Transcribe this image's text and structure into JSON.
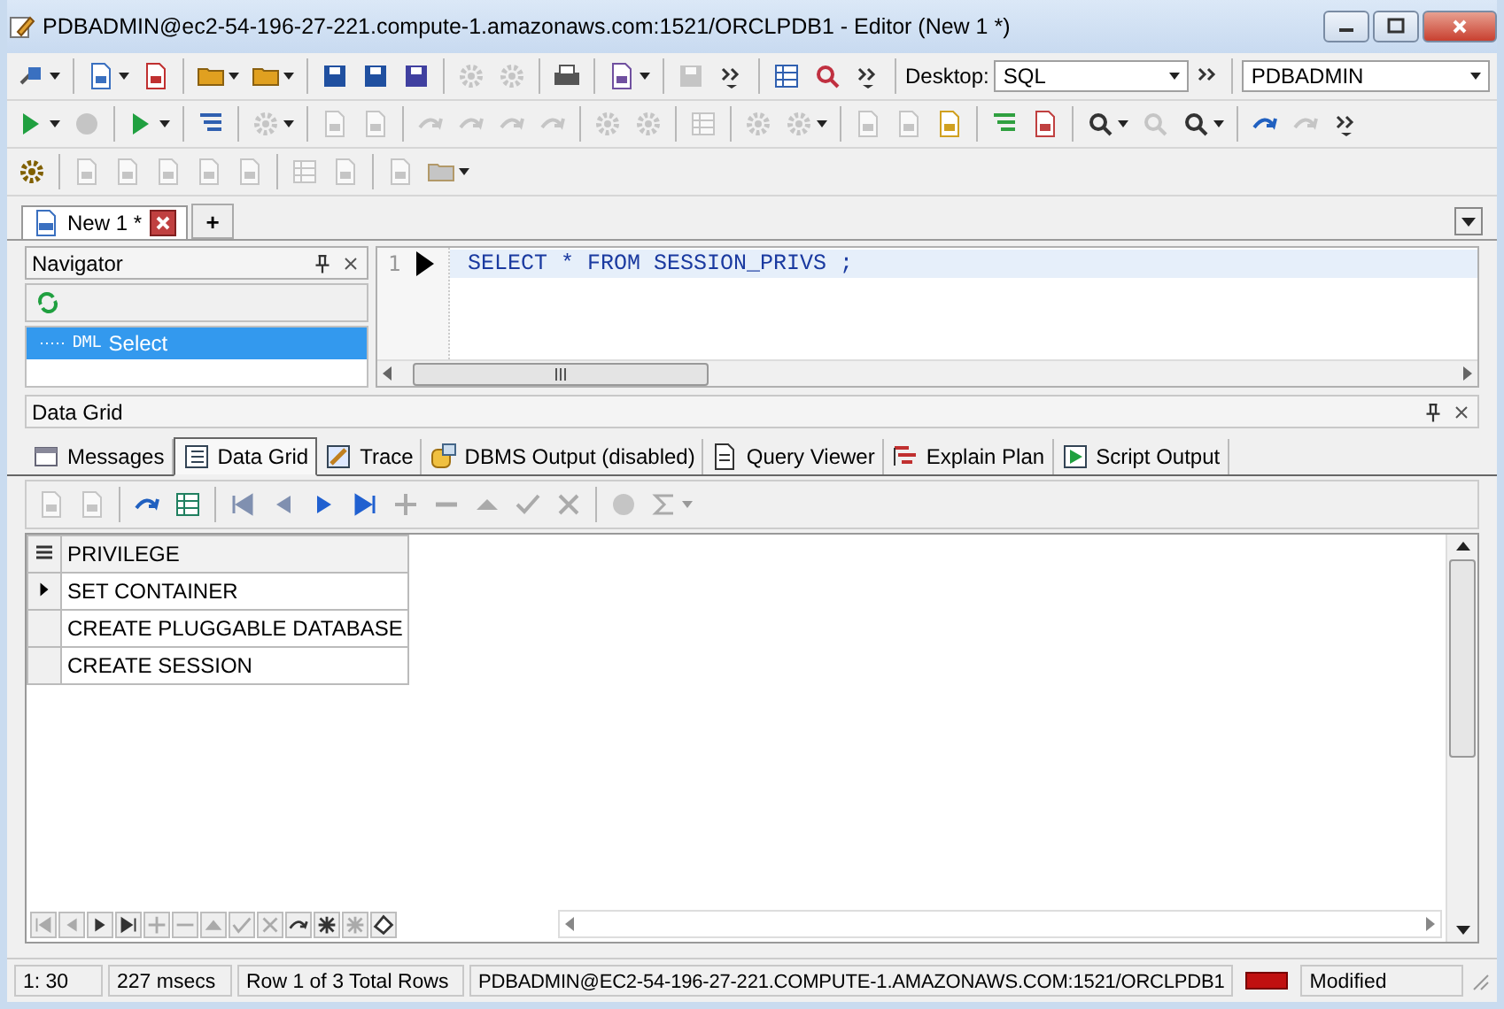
{
  "window": {
    "title": "PDBADMIN@ec2-54-196-27-221.compute-1.amazonaws.com:1521/ORCLPDB1 - Editor (New 1 *)"
  },
  "toolbar": {
    "desktop_label": "Desktop:",
    "desktop_value": "SQL",
    "connection": "PDBADMIN"
  },
  "doc_tabs": [
    {
      "label": "New 1 *",
      "selected": true
    }
  ],
  "new_tab_button": "+",
  "navigator": {
    "title": "Navigator",
    "items": [
      {
        "tag": "DML",
        "label": "Select",
        "selected": true
      }
    ]
  },
  "editor": {
    "lines": [
      {
        "number": "1",
        "code": "SELECT * FROM SESSION_PRIVS ;"
      }
    ]
  },
  "data_grid_panel": {
    "title": "Data Grid"
  },
  "result_tabs": [
    {
      "label": "Messages",
      "selected": false
    },
    {
      "label": "Data Grid",
      "selected": true
    },
    {
      "label": "Trace",
      "selected": false
    },
    {
      "label": "DBMS Output (disabled)",
      "selected": false
    },
    {
      "label": "Query Viewer",
      "selected": false
    },
    {
      "label": "Explain Plan",
      "selected": false
    },
    {
      "label": "Script Output",
      "selected": false
    }
  ],
  "table": {
    "columns": [
      "PRIVILEGE"
    ],
    "rows": [
      {
        "cells": [
          "SET CONTAINER"
        ],
        "current": true
      },
      {
        "cells": [
          "CREATE PLUGGABLE DATABASE"
        ],
        "current": false
      },
      {
        "cells": [
          "CREATE SESSION"
        ],
        "current": false
      }
    ]
  },
  "status_bar": {
    "position": "1: 30",
    "time": "227 msecs",
    "row_info": "Row 1 of 3 Total Rows",
    "connection": "PDBADMIN@EC2-54-196-27-221.COMPUTE-1.AMAZONAWS.COM:1521/ORCLPDB1",
    "state": "Modified"
  }
}
